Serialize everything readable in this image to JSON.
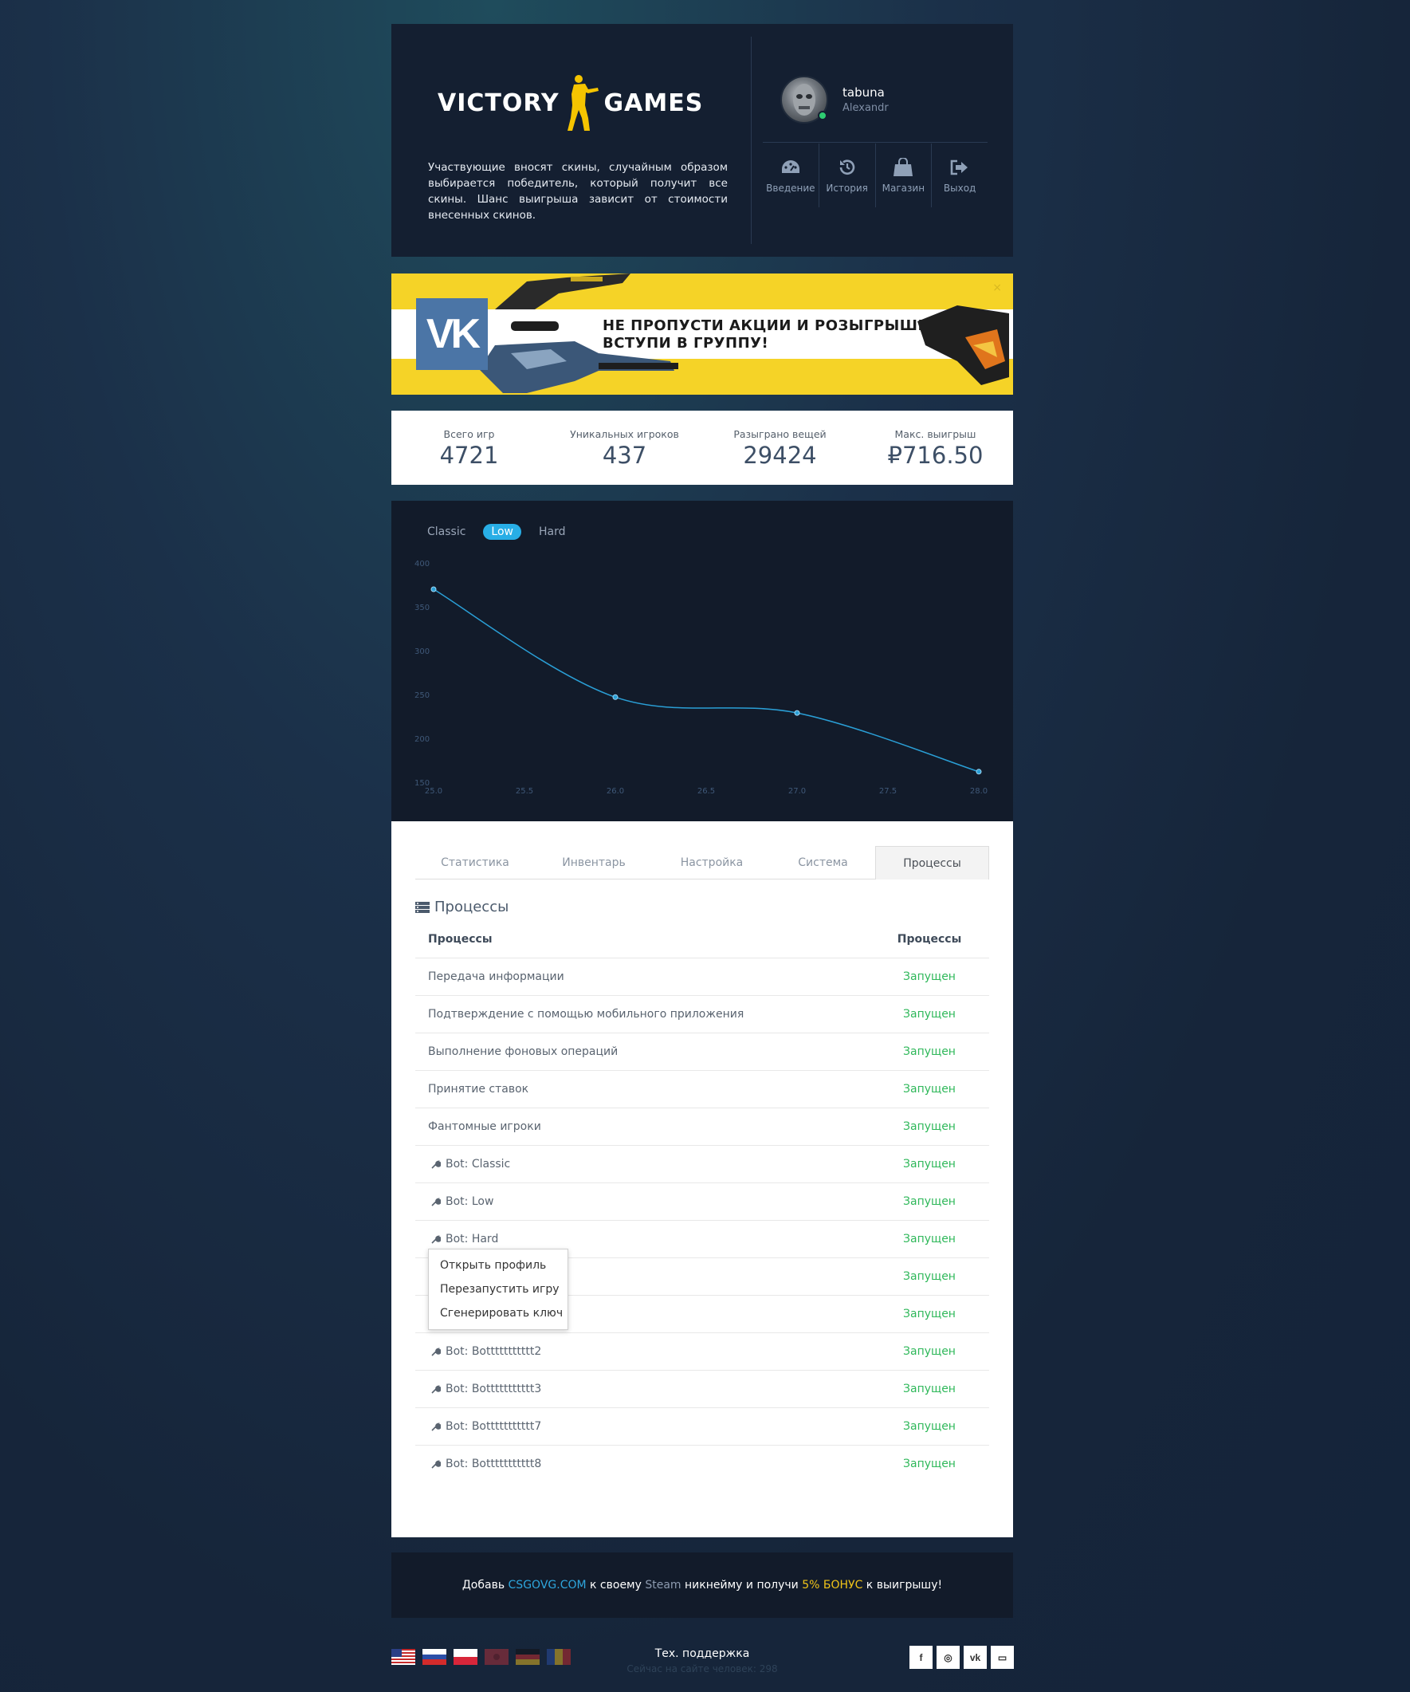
{
  "header": {
    "logo_left": "VICTORY",
    "logo_right": "GAMES",
    "description": "Участвующие вносят скины, случайным образом выбирается победитель, который получит все скины. Шанс выигрыша зависит от стоимости внесенных скинов.",
    "user": {
      "name": "tabuna",
      "subname": "Alexandr"
    },
    "menu": [
      {
        "label": "Введение",
        "icon": "dashboard-icon"
      },
      {
        "label": "История",
        "icon": "history-icon"
      },
      {
        "label": "Магазин",
        "icon": "shopping-bag-icon"
      },
      {
        "label": "Выход",
        "icon": "logout-icon"
      }
    ]
  },
  "banner": {
    "logo": "VK",
    "line1": "НЕ ПРОПУСТИ АКЦИИ И РОЗЫГРЫШИ,",
    "line2": "ВСТУПИ В ГРУППУ!",
    "close": "×"
  },
  "stats": [
    {
      "label": "Всего игр",
      "value": "4721"
    },
    {
      "label": "Уникальных игроков",
      "value": "437"
    },
    {
      "label": "Разыграно вещей",
      "value": "29424"
    },
    {
      "label": "Макс. выигрыш",
      "value": "₽716.50"
    }
  ],
  "modes": [
    {
      "label": "Classic",
      "active": false
    },
    {
      "label": "Low",
      "active": true
    },
    {
      "label": "Hard",
      "active": false
    }
  ],
  "chart_data": {
    "type": "line",
    "x": [
      25.0,
      26.0,
      27.0,
      28.0
    ],
    "series": [
      {
        "values": [
          370,
          247,
          229,
          162
        ]
      }
    ],
    "xlim": [
      25.0,
      28.0
    ],
    "ylim": [
      150,
      400
    ],
    "xticks": [
      "25.0",
      "25.5",
      "26.0",
      "26.5",
      "27.0",
      "27.5",
      "28.0"
    ],
    "yticks": [
      "150",
      "200",
      "250",
      "300",
      "350",
      "400"
    ],
    "line_color": "#2a9fd6",
    "grid": false
  },
  "tabs": [
    {
      "label": "Статистика",
      "active": false
    },
    {
      "label": "Инвентарь",
      "active": false
    },
    {
      "label": "Настройка",
      "active": false
    },
    {
      "label": "Система",
      "active": false
    },
    {
      "label": "Процессы",
      "active": true
    }
  ],
  "processes": {
    "title": "Процессы",
    "col1": "Процессы",
    "col2": "Процессы",
    "rows": [
      {
        "name": "Передача информации",
        "status": "Запущен",
        "bot": false
      },
      {
        "name": "Подтверждение с помощью мобильного приложения",
        "status": "Запущен",
        "bot": false
      },
      {
        "name": "Выполнение фоновых операций",
        "status": "Запущен",
        "bot": false
      },
      {
        "name": "Принятие ставок",
        "status": "Запущен",
        "bot": false
      },
      {
        "name": "Фантомные игроки",
        "status": "Запущен",
        "bot": false
      },
      {
        "name": "Bot: Classic",
        "status": "Запущен",
        "bot": true
      },
      {
        "name": "Bot: Low",
        "status": "Запущен",
        "bot": true
      },
      {
        "name": "Bot: Hard",
        "status": "Запущен",
        "bot": true
      },
      {
        "name": "",
        "status": "Запущен",
        "bot": false
      },
      {
        "name": "",
        "status": "Запущен",
        "bot": false
      },
      {
        "name": "Bot: Bottttttttttt2",
        "status": "Запущен",
        "bot": true
      },
      {
        "name": "Bot: Bottttttttttt3",
        "status": "Запущен",
        "bot": true
      },
      {
        "name": "Bot: Bottttttttttt7",
        "status": "Запущен",
        "bot": true
      },
      {
        "name": "Bot: Bottttttttttt8",
        "status": "Запущен",
        "bot": true
      }
    ]
  },
  "context_menu": [
    "Открыть профиль",
    "Перезапустить игру",
    "Сгенерировать ключ"
  ],
  "promo": {
    "p1": "Добавь ",
    "site": "CSGOVG.COM",
    "p2": " к своему ",
    "steam": "Steam",
    "p3": " никнейму и получи ",
    "bonus": "5% БОНУС",
    "p4": " к выигрышу!"
  },
  "footer": {
    "support": "Тех. поддержка",
    "online": "Сейчас на сайте человек: 298",
    "flags": [
      "us-flag-icon",
      "ru-flag-icon",
      "pl-flag-icon",
      "flag-icon",
      "de-flag-icon",
      "flag-icon"
    ],
    "socials": [
      {
        "icon": "facebook-icon",
        "glyph": "f"
      },
      {
        "icon": "instagram-icon",
        "glyph": "◎"
      },
      {
        "icon": "vk-icon",
        "glyph": "vk"
      },
      {
        "icon": "twitch-icon",
        "glyph": "▭"
      }
    ]
  },
  "colors": {
    "accent": "#28aee6",
    "status_running": "#2fb85a",
    "banner_yellow": "#f5d327",
    "vk_blue": "#4b75a6",
    "panel_dark": "#141f31"
  }
}
